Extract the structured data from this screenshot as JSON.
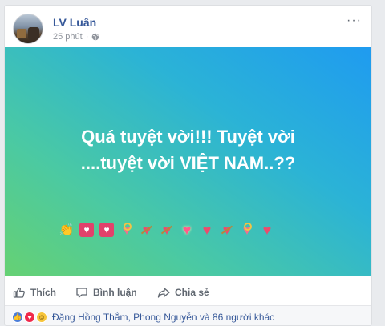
{
  "post": {
    "author": "LV Luân",
    "time": "25 phút",
    "more": "···",
    "text_line1": "Quá tuyệt vời!!! Tuyệt vời",
    "text_line2": "....tuyệt vời VIỆT NAM..??"
  },
  "actions": {
    "like": "Thích",
    "comment": "Bình luận",
    "share": "Chia sẻ"
  },
  "reactions": {
    "summary": "Đặng Hồng Thắm, Phong Nguyễn và 86 người khác",
    "icons": [
      "like-icon",
      "love-icon",
      "haha-icon"
    ]
  },
  "colors": {
    "link": "#365899",
    "banner_start": "#1f9bf0",
    "banner_end": "#66d173"
  }
}
